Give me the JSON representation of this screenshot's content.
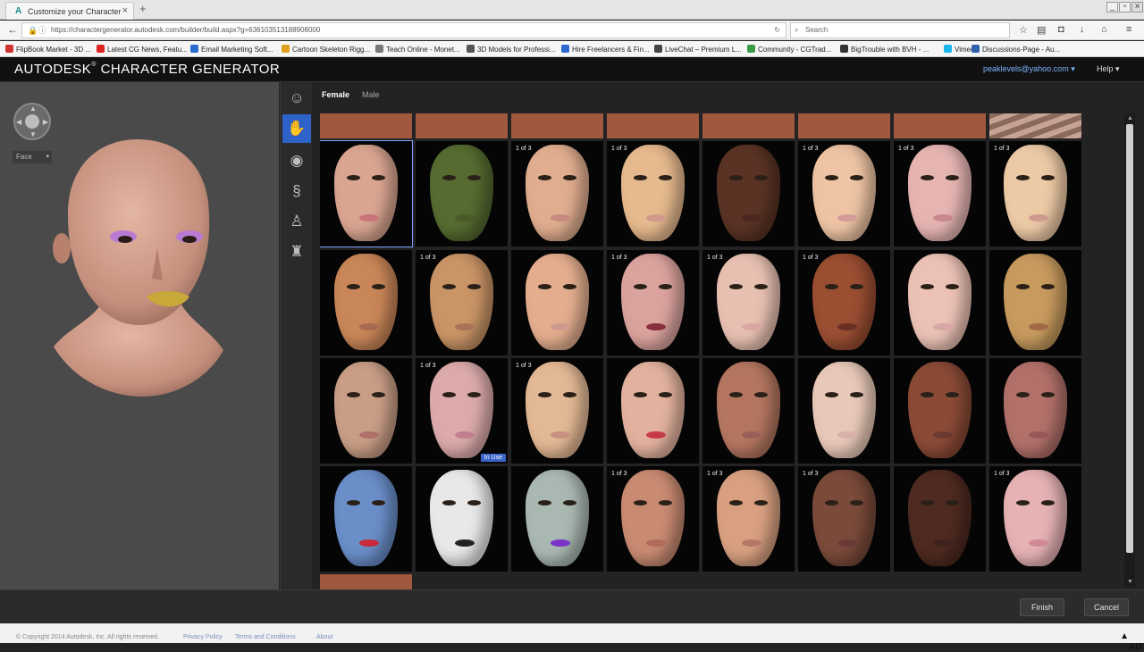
{
  "browser": {
    "tab_title": "Customize your Character",
    "url": "https://charactergenerator.autodesk.com/builder/build.aspx?g=636103513188908000",
    "search_placeholder": "Search"
  },
  "bookmarks": [
    {
      "label": "FlipBook Market - 3D ...",
      "color": "#c33"
    },
    {
      "label": "Latest CG News, Featu...",
      "color": "#d22"
    },
    {
      "label": "Email Marketing Soft...",
      "color": "#2a6ad0"
    },
    {
      "label": "Cartoon Skeleton Rigg...",
      "color": "#e0a020"
    },
    {
      "label": "Teach Online - Monet...",
      "color": "#777"
    },
    {
      "label": "3D Models for Professi...",
      "color": "#555"
    },
    {
      "label": "Hire Freelancers & Fin...",
      "color": "#2a6ad0"
    },
    {
      "label": "LiveChat – Premium L...",
      "color": "#444"
    },
    {
      "label": "Community - CGTrad...",
      "color": "#3a9a4a"
    },
    {
      "label": "BigTrouble with BVH - ...",
      "color": "#333"
    },
    {
      "label": "Vimeo",
      "color": "#1ab7ea"
    },
    {
      "label": "Discussions-Page - Au...",
      "color": "#3060b0"
    }
  ],
  "app": {
    "brand": "AUTODESK",
    "registered": "®",
    "product": "CHARACTER GENERATOR",
    "user_email": "peaklevels@yahoo.com",
    "help_label": "Help"
  },
  "viewport": {
    "view_dropdown": "Face"
  },
  "gender_tabs": {
    "female": "Female",
    "male": "Male"
  },
  "grid": {
    "count_label": "1 of 3",
    "in_use_label": "In Use",
    "rows": [
      [
        {
          "skin": "#d9a591",
          "lip": "#c9737a",
          "sel": true
        },
        {
          "skin": "#556b30",
          "lip": "#4a5a28"
        },
        {
          "skin": "#e0ad8e",
          "lip": "#c88a80",
          "count": true
        },
        {
          "skin": "#e6b98e",
          "lip": "#d19a8c",
          "count": true
        },
        {
          "skin": "#5a3325",
          "lip": "#4a2820"
        },
        {
          "skin": "#eec4a4",
          "lip": "#d39a96",
          "count": true
        },
        {
          "skin": "#e6b5b2",
          "lip": "#c9878e",
          "count": true
        },
        {
          "skin": "#edcaa6",
          "lip": "#cf9a8e",
          "count": true
        }
      ],
      [
        {
          "skin": "#c98658",
          "lip": "#a86a52"
        },
        {
          "skin": "#c99466",
          "lip": "#a77458",
          "count": true
        },
        {
          "skin": "#e4ae8e",
          "lip": "#cf9a8e"
        },
        {
          "skin": "#dba39e",
          "lip": "#8a2e3e",
          "count": true
        },
        {
          "skin": "#e8c0b2",
          "lip": "#d7a8a4",
          "count": true
        },
        {
          "skin": "#9a4e32",
          "lip": "#6a2e24",
          "count": true
        },
        {
          "skin": "#ecc2b6",
          "lip": "#d8a8a4"
        },
        {
          "skin": "#c79a5e",
          "lip": "#a06a48"
        }
      ],
      [
        {
          "skin": "#c99d86",
          "lip": "#b0706a"
        },
        {
          "skin": "#dcaaaa",
          "lip": "#c37f8f",
          "count": true,
          "inuse": true
        },
        {
          "skin": "#e3b894",
          "lip": "#c8907e",
          "count": true
        },
        {
          "skin": "#e2b29e",
          "lip": "#c83a4a"
        },
        {
          "skin": "#b47660",
          "lip": "#9a6058"
        },
        {
          "skin": "#e8c8b8",
          "lip": "#d9b0a8"
        },
        {
          "skin": "#8a4a36",
          "lip": "#6a3a30"
        },
        {
          "skin": "#b2706a",
          "lip": "#985858"
        }
      ],
      [
        {
          "skin": "#6a8ec8",
          "lip": "#c82a3a"
        },
        {
          "skin": "#e8e8e8",
          "lip": "#222"
        },
        {
          "skin": "#aab8b2",
          "lip": "#7a32c8"
        },
        {
          "skin": "#c98a72",
          "lip": "#b06a5a",
          "count": true
        },
        {
          "skin": "#d8a080",
          "lip": "#b57868",
          "count": true
        },
        {
          "skin": "#7a4a3a",
          "lip": "#6a3a38",
          "count": true
        },
        {
          "skin": "#4e2a20",
          "lip": "#3e221c"
        },
        {
          "skin": "#e6b2b4",
          "lip": "#cf8a94",
          "count": true
        }
      ]
    ]
  },
  "buttons": {
    "finish": "Finish",
    "cancel": "Cancel"
  },
  "footer": {
    "copyright": "© Copyright 2014 Autodesk, Inc. All rights reserved.",
    "privacy": "Privacy Policy",
    "terms": "Terms and Conditions",
    "about": "About",
    "logo": "AUTODESK."
  }
}
